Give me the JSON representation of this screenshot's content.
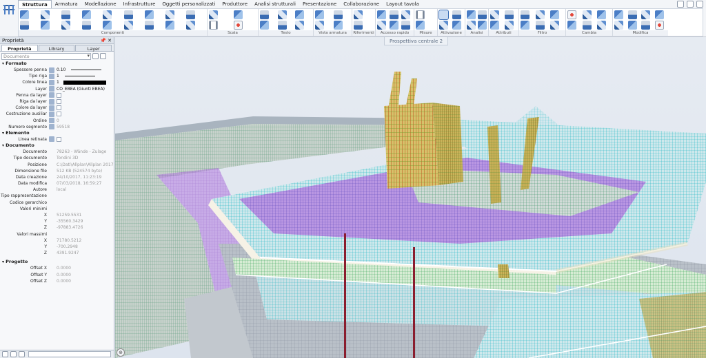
{
  "ribbon": {
    "tabs": [
      "Struttura",
      "Armatura",
      "Modellazione",
      "Infrastrutture",
      "Oggetti personalizzati",
      "Produttore",
      "Analisi strutturali",
      "Presentazione",
      "Collaborazione",
      "Layout tavola"
    ],
    "active_tab": "Struttura",
    "groups": [
      "Componenti",
      "Scala",
      "Testo",
      "Vista armatura",
      "Riferimenti",
      "Accesso rapido",
      "Misure",
      "Attivazione",
      "Analisi",
      "Attributi",
      "Filtro",
      "Cambia",
      "Modifica"
    ]
  },
  "palette": {
    "title": "Proprietà",
    "tabs": [
      "Proprietà",
      "Library",
      "Layer"
    ],
    "selector_placeholder": "Documento",
    "sections": {
      "formato": "Formato",
      "elemento": "Elemento",
      "documento": "Documento",
      "progetto": "Progetto"
    },
    "formato": {
      "spessore_penna": {
        "label": "Spessore penna",
        "value": "0.10"
      },
      "tipo_riga": {
        "label": "Tipo riga",
        "value": "1"
      },
      "colore_linea": {
        "label": "Colore linea",
        "value": "1"
      },
      "layer": {
        "label": "Layer",
        "value": "CO_EBEA (Giunti EBEA)"
      },
      "penna_da_layer": {
        "label": "Penna da layer"
      },
      "riga_da_layer": {
        "label": "Riga da layer"
      },
      "colore_da_layer": {
        "label": "Colore da layer"
      },
      "costruzione_ausiliar": {
        "label": "Costruzione ausiliar"
      },
      "ordine": {
        "label": "Ordine",
        "value": "0"
      },
      "numero_segmento": {
        "label": "Numero segmento",
        "value": "59518"
      }
    },
    "elemento": {
      "linea_retinata": {
        "label": "Linea retinata"
      }
    },
    "documento": {
      "documento": {
        "label": "Documento",
        "value": "78263 - Wände - Zulage"
      },
      "tipo_documento": {
        "label": "Tipo documento",
        "value": "Tondini 3D"
      },
      "posizione": {
        "label": "Posizione",
        "value": "C:\\Dati\\Allplan\\Allplan 2017"
      },
      "dimensione_file": {
        "label": "Dimensione file",
        "value": "512 KB (524574 byte)"
      },
      "data_creazione": {
        "label": "Data creazione",
        "value": "24/10/2017, 11:23:19"
      },
      "data_modifica": {
        "label": "Data modifica",
        "value": "07/03/2018, 16:59:27"
      },
      "autore": {
        "label": "Autore",
        "value": "local"
      },
      "tipo_rappresentazione": {
        "label": "Tipo rappresentazione",
        "value": ""
      },
      "codice_gerarchico": {
        "label": "Codice gerarchico",
        "value": ""
      },
      "valori_minimi": {
        "label": "Valori minimi"
      },
      "min_x": {
        "label": "X",
        "value": "51259.5531"
      },
      "min_y": {
        "label": "Y",
        "value": "-35560.3429"
      },
      "min_z": {
        "label": "Z",
        "value": "-97883.4726"
      },
      "valori_massimi": {
        "label": "Valori massimi"
      },
      "max_x": {
        "label": "X",
        "value": "71780.5212"
      },
      "max_y": {
        "label": "Y",
        "value": "-700.2948"
      },
      "max_z": {
        "label": "Z",
        "value": "4391.9247"
      }
    },
    "progetto": {
      "offset_x": {
        "label": "Offset X",
        "value": "0.0000"
      },
      "offset_y": {
        "label": "Offset Y",
        "value": "0.0000"
      },
      "offset_z": {
        "label": "Offset Z",
        "value": "0.0000"
      }
    }
  },
  "viewport": {
    "title": "Prospettiva centrale 2"
  }
}
